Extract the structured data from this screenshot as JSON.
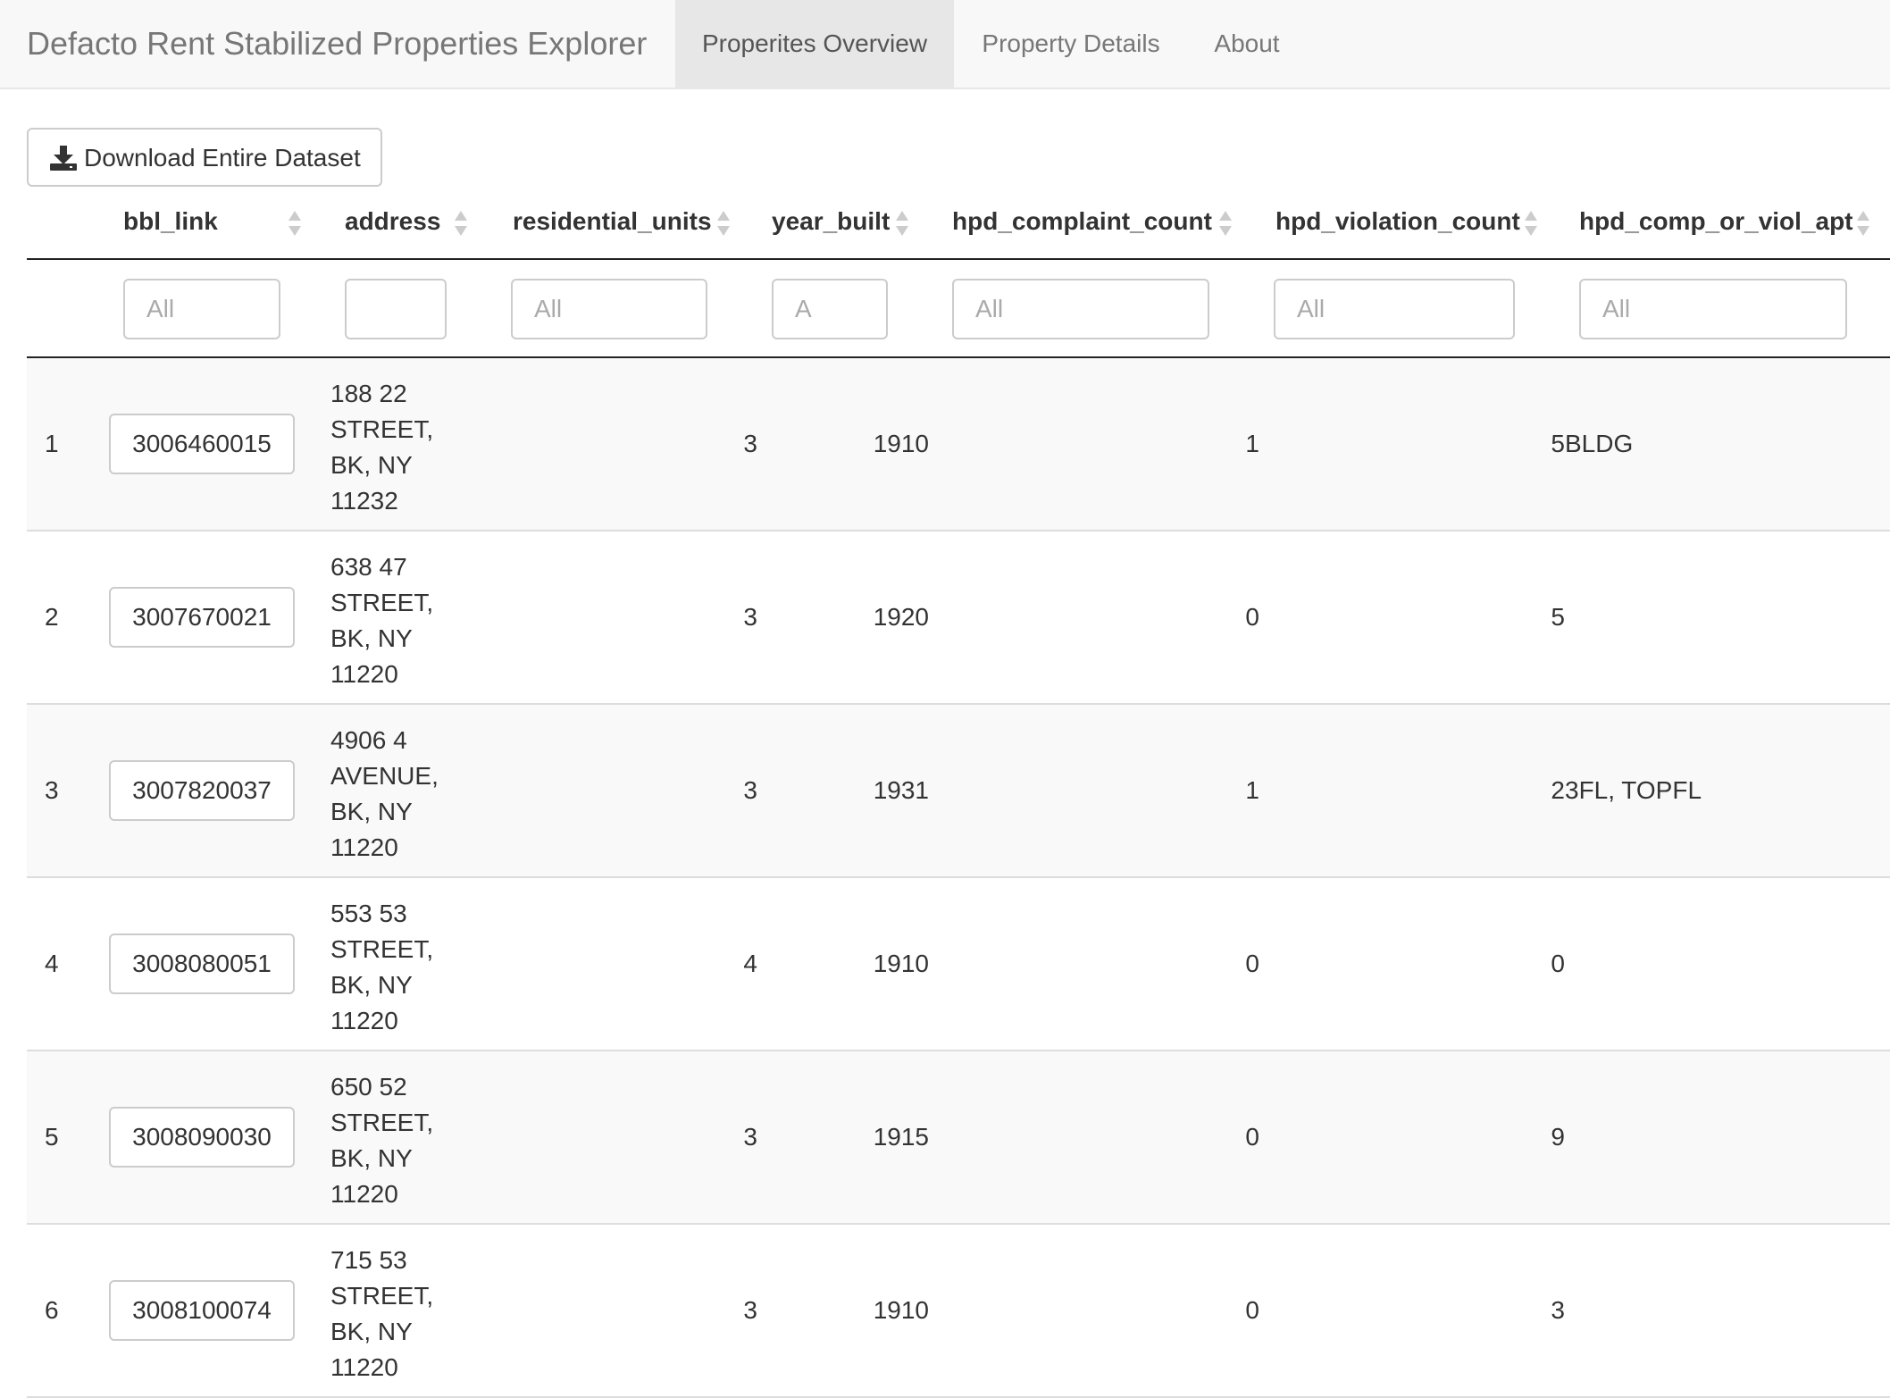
{
  "app": {
    "title": "Defacto Rent Stabilized Properties Explorer",
    "tabs": [
      "Properites Overview",
      "Property Details",
      "About"
    ],
    "active_tab": 0
  },
  "toolbar": {
    "download_label": "Download Entire Dataset",
    "download_icon": "download-icon"
  },
  "table": {
    "columns": [
      "bbl_link",
      "address",
      "residential_units",
      "year_built",
      "hpd_complaint_count",
      "hpd_violation_count",
      "hpd_comp_or_viol_apt"
    ],
    "filters": {
      "bbl_link": {
        "value": "",
        "placeholder": "All"
      },
      "address": {
        "value": "",
        "placeholder": ""
      },
      "residential_units": {
        "value": "",
        "placeholder": "All"
      },
      "year_built": {
        "value": "",
        "placeholder": "A"
      },
      "hpd_complaint_count": {
        "value": "",
        "placeholder": "All"
      },
      "hpd_violation_count": {
        "value": "",
        "placeholder": "All"
      },
      "hpd_comp_or_viol_apt": {
        "value": "",
        "placeholder": "All"
      }
    },
    "rows": [
      {
        "num": "1",
        "bbl": "3006460015",
        "address": "188 22\nSTREET,\nBK, NY\n11232",
        "units": "3",
        "year": "1910",
        "complaints": "1",
        "violations": "5",
        "apt": "BLDG"
      },
      {
        "num": "2",
        "bbl": "3007670021",
        "address": "638 47\nSTREET,\nBK, NY\n11220",
        "units": "3",
        "year": "1920",
        "complaints": "0",
        "violations": "5",
        "apt": ""
      },
      {
        "num": "3",
        "bbl": "3007820037",
        "address": "4906 4\nAVENUE,\nBK, NY\n11220",
        "units": "3",
        "year": "1931",
        "complaints": "1",
        "violations": "2",
        "apt": "3FL, TOPFL"
      },
      {
        "num": "4",
        "bbl": "3008080051",
        "address": "553 53\nSTREET,\nBK, NY\n11220",
        "units": "4",
        "year": "1910",
        "complaints": "0",
        "violations": "0",
        "apt": ""
      },
      {
        "num": "5",
        "bbl": "3008090030",
        "address": "650 52\nSTREET,\nBK, NY\n11220",
        "units": "3",
        "year": "1915",
        "complaints": "0",
        "violations": "9",
        "apt": ""
      },
      {
        "num": "6",
        "bbl": "3008100074",
        "address": "715 53\nSTREET,\nBK, NY\n11220",
        "units": "3",
        "year": "1910",
        "complaints": "0",
        "violations": "3",
        "apt": ""
      }
    ]
  }
}
